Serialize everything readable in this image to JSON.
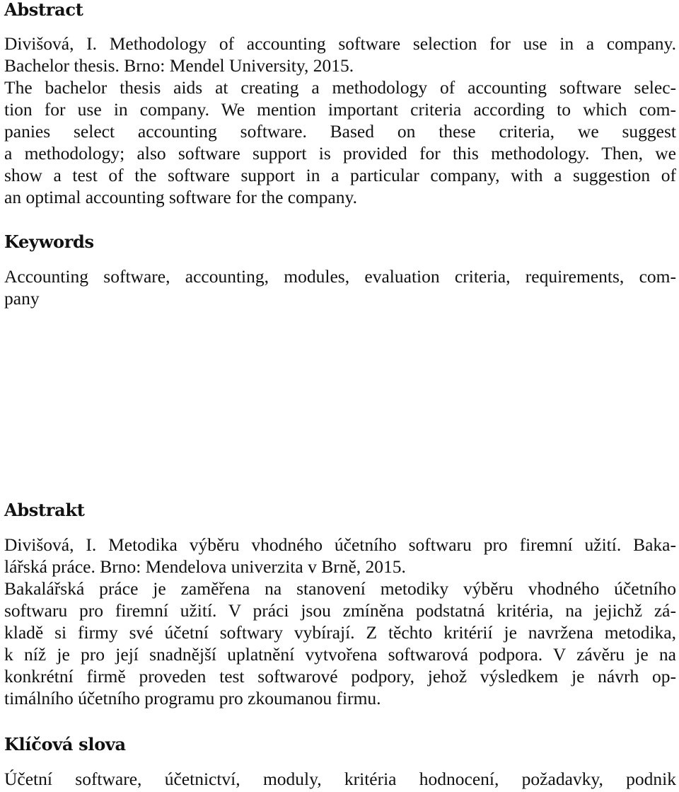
{
  "abstract_en": {
    "heading": "Abstract",
    "lines": [
      "Divišová, I. Methodology of accounting software selection for use in a company.",
      "Bachelor thesis. Brno: Mendel University, 2015.",
      "The bachelor thesis aids at creating a methodology of accounting software selec-",
      "tion for use in company. We mention important criteria according to which com-",
      "panies select accounting software. Based on these criteria, we suggest",
      "a methodology; also software support is provided for this methodology. Then, we",
      "show a test of the software support in a particular company, with a suggestion of",
      "an optimal accounting software for the company."
    ]
  },
  "keywords_en": {
    "heading": "Keywords",
    "lines": [
      "Accounting software, accounting, modules, evaluation criteria, requirements, com-",
      "pany"
    ]
  },
  "abstract_cz": {
    "heading": "Abstrakt",
    "lines": [
      "Divišová, I. Metodika výběru vhodného účetního softwaru pro firemní užití. Baka-",
      "lářská práce. Brno: Mendelova univerzita v Brně, 2015.",
      "Bakalářská práce je zaměřena na stanovení metodiky výběru vhodného účetního",
      "softwaru pro firemní užití. V práci jsou zmíněna podstatná kritéria, na jejichž zá-",
      "kladě si firmy své účetní softwary vybírají. Z těchto kritérií je navržena metodika,",
      "k níž je pro její snadnější uplatnění vytvořena softwarová podpora. V závěru je na",
      "konkrétní firmě proveden test softwarové podpory, jehož výsledkem je návrh op-",
      "timálního účetního programu pro zkoumanou firmu."
    ]
  },
  "keywords_cz": {
    "heading": "Klíčová slova",
    "lines": [
      "Účetní software, účetnictví, moduly, kritéria hodnocení, požadavky, podnik"
    ]
  }
}
